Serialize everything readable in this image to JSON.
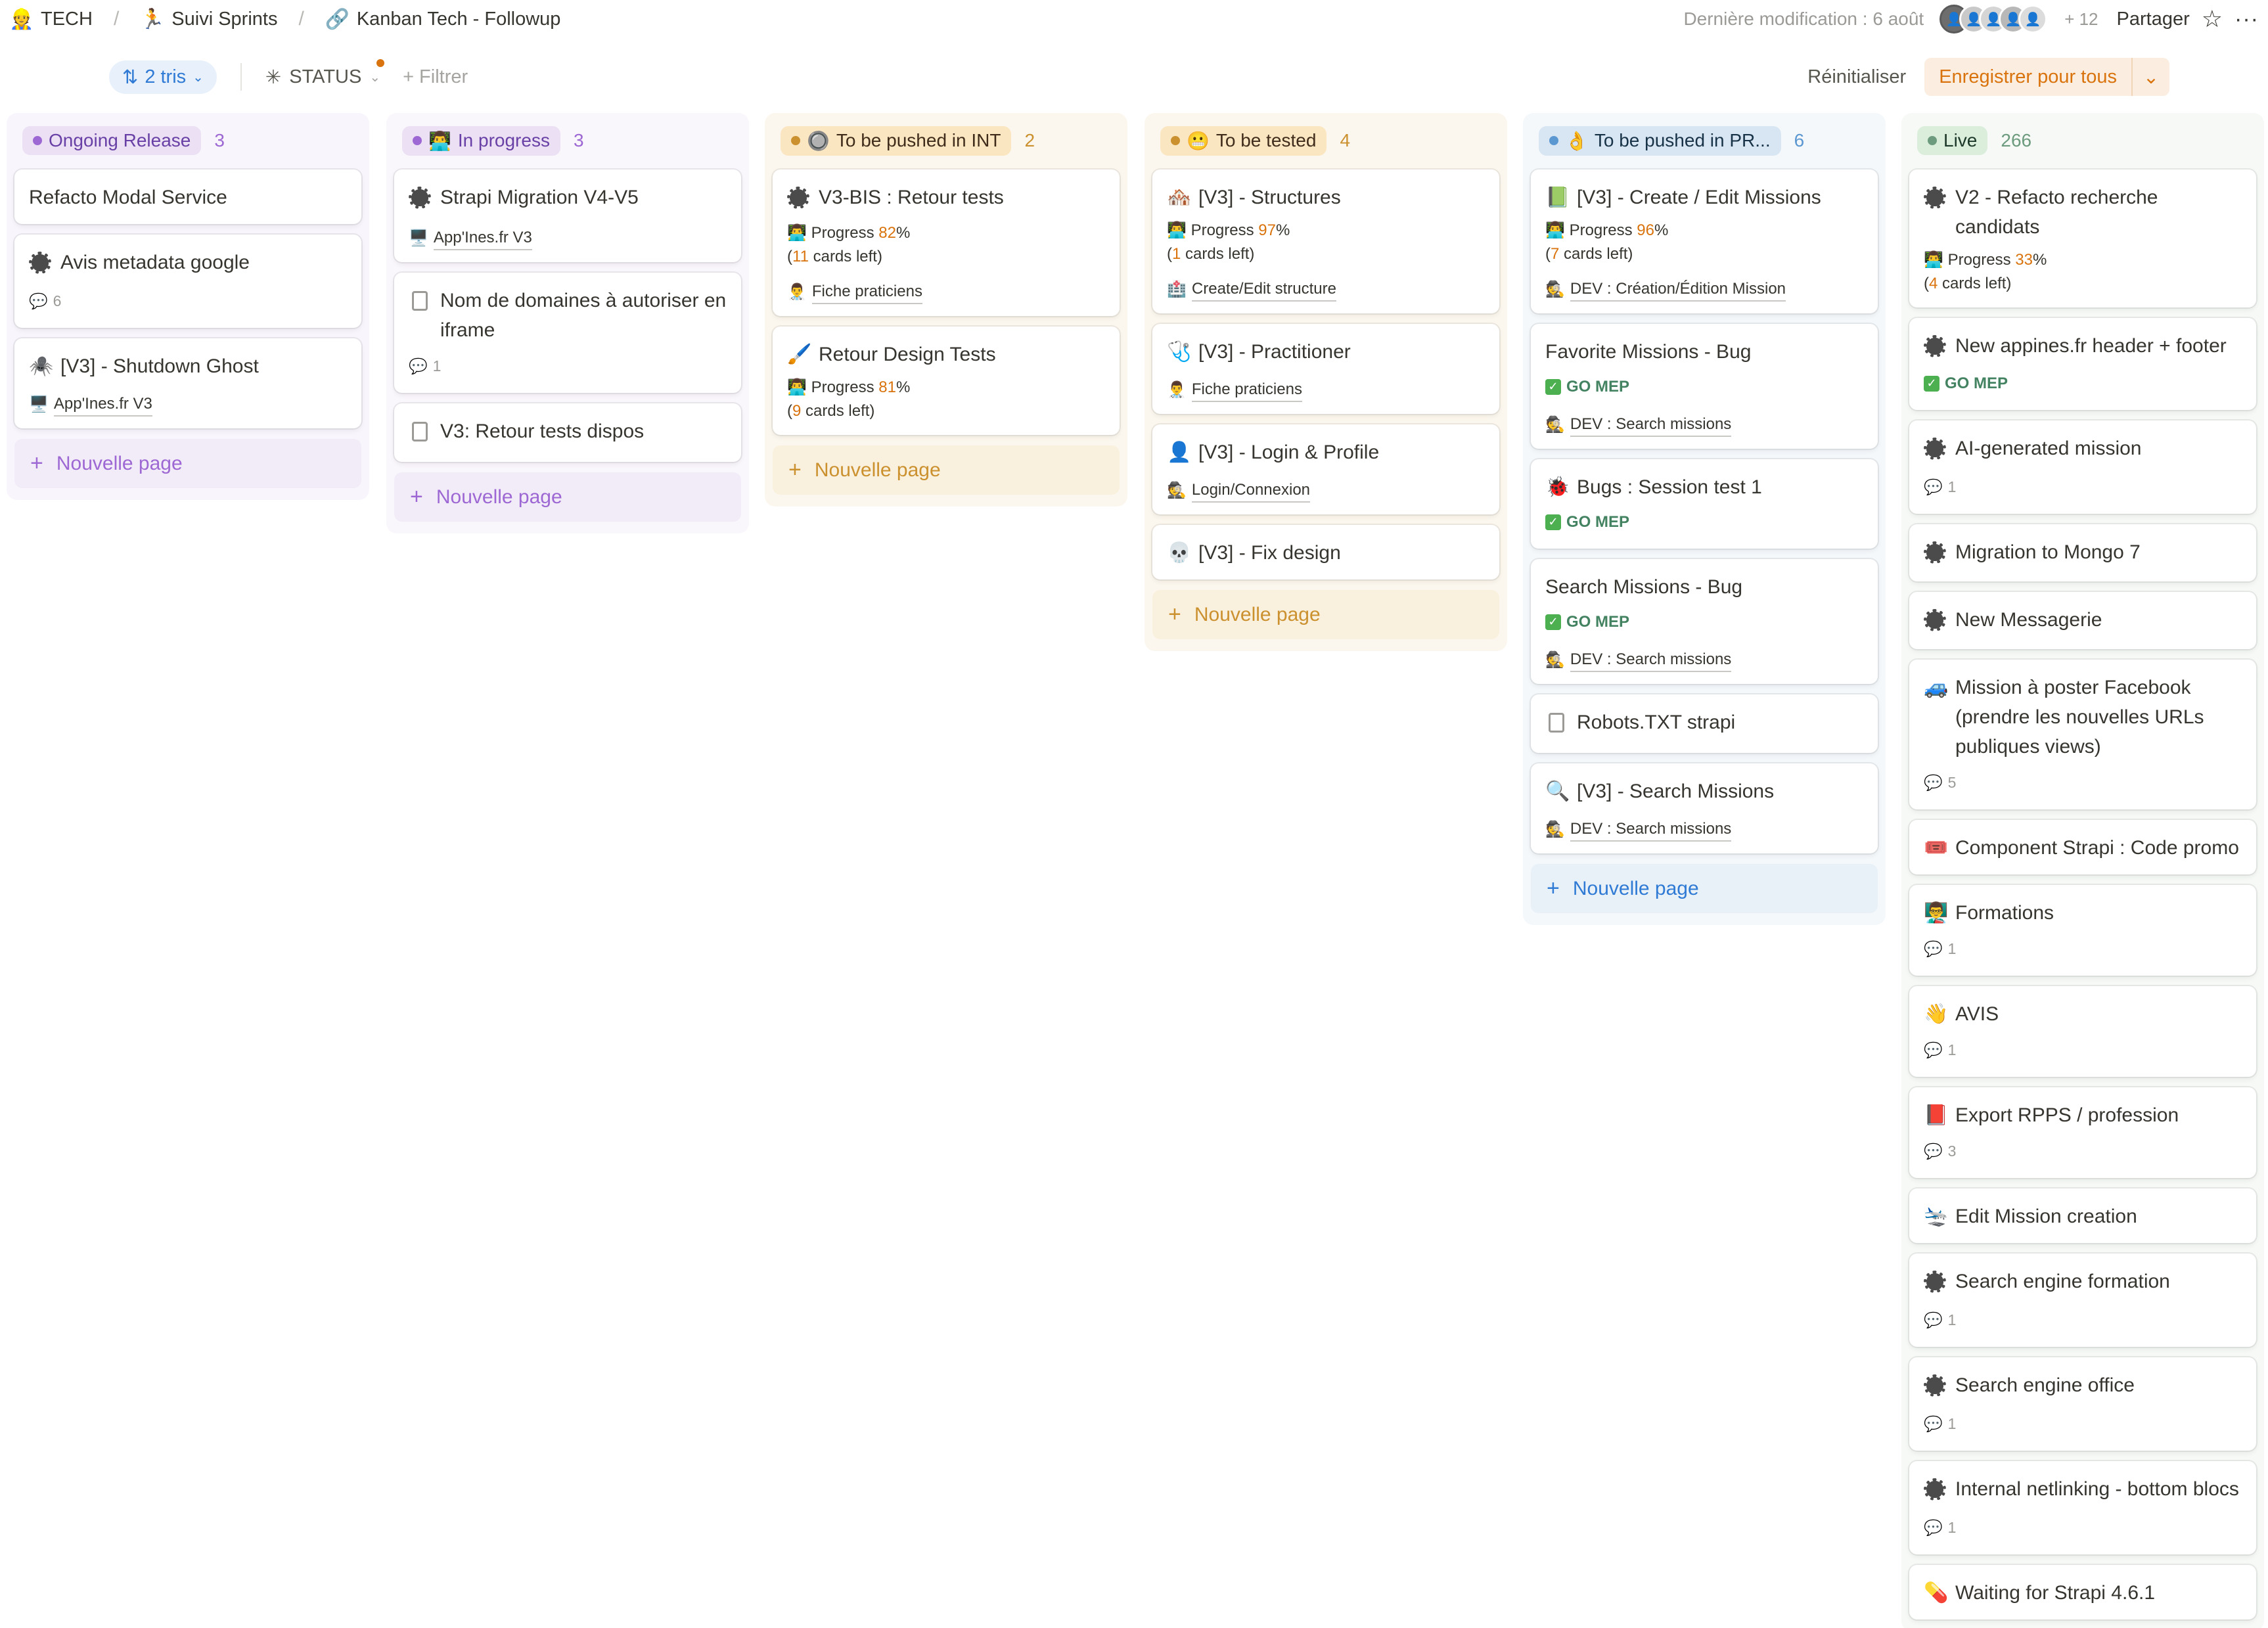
{
  "topbar": {
    "breadcrumbs": [
      {
        "icon": "👷",
        "label": "TECH"
      },
      {
        "icon": "🏃",
        "label": "Suivi Sprints"
      },
      {
        "icon": "🔗",
        "label": "Kanban Tech - Followup"
      }
    ],
    "last_modified": "Dernière modification : 6 août",
    "avatar_more": "+ 12",
    "share_label": "Partager",
    "star_icon": "☆",
    "more_icon": "···"
  },
  "toolbar": {
    "sort_label": "2 tris",
    "group_label": "STATUS",
    "filter_label": "Filtrer",
    "reset_label": "Réinitialiser",
    "save_label": "Enregistrer pour tous"
  },
  "columns": [
    {
      "label": "Ongoing Release",
      "count": "3",
      "tag_icon": "",
      "bg": "#f8f5fc",
      "tag_bg": "#ebe0f4",
      "dot": "#9d68d3",
      "text": "#6940a5",
      "new_page": "Nouvelle page",
      "cards": [
        {
          "title": "Refacto Modal Service",
          "icon": "none"
        },
        {
          "title": "Avis metadata google",
          "icon": "gear",
          "comments": "6"
        },
        {
          "title": "[V3] - Shutdown Ghost",
          "icon": "🕷️",
          "relation": {
            "icon": "🖥️",
            "label": "App'Ines.fr V3"
          }
        }
      ]
    },
    {
      "label": "In progress",
      "count": "3",
      "tag_icon": "👨‍💻",
      "bg": "#f9f6fc",
      "tag_bg": "#ebe0f4",
      "dot": "#9d68d3",
      "text": "#6940a5",
      "new_page": "Nouvelle page",
      "cards": [
        {
          "title": "Strapi Migration V4-V5",
          "icon": "gear",
          "relation": {
            "icon": "🖥️",
            "label": "App'Ines.fr V3"
          }
        },
        {
          "title": "Nom de domaines à autoriser en iframe",
          "icon": "doc",
          "comments": "1"
        },
        {
          "title": "V3: Retour tests dispos",
          "icon": "doc"
        }
      ]
    },
    {
      "label": "To be pushed in INT",
      "count": "2",
      "tag_icon": "🔘",
      "bg": "#fcf7ee",
      "tag_bg": "#fbe6c2",
      "dot": "#cb912f",
      "text": "#402c1b",
      "new_page": "Nouvelle page",
      "cards": [
        {
          "title": "V3-BIS : Retour tests",
          "icon": "gear",
          "progress": "82",
          "cards_left": "11",
          "relation": {
            "icon": "👨‍⚕️",
            "label": "Fiche praticiens"
          }
        },
        {
          "title": "Retour Design Tests",
          "icon": "🖌️",
          "progress": "81",
          "cards_left": "9"
        }
      ]
    },
    {
      "label": "To be tested",
      "count": "4",
      "tag_icon": "😬",
      "bg": "#fcf7ee",
      "tag_bg": "#fbe6c2",
      "dot": "#cb912f",
      "text": "#402c1b",
      "new_page": "Nouvelle page",
      "cards": [
        {
          "title": "[V3] - Structures",
          "icon": "🏘️",
          "progress": "97",
          "cards_left": "1",
          "relation": {
            "icon": "🏥",
            "label": "Create/Edit structure"
          }
        },
        {
          "title": "[V3] - Practitioner",
          "icon": "🩺",
          "relation": {
            "icon": "👨‍⚕️",
            "label": "Fiche praticiens"
          }
        },
        {
          "title": "[V3] - Login & Profile",
          "icon": "👤",
          "relation": {
            "icon": "🕵️",
            "label": "Login/Connexion"
          }
        },
        {
          "title": "[V3] - Fix design",
          "icon": "💀"
        }
      ]
    },
    {
      "label": "To be pushed in PR...",
      "count": "6",
      "tag_icon": "👌",
      "bg": "#f4f8fb",
      "tag_bg": "#d8e6f3",
      "dot": "#5b97d0",
      "text": "#183347",
      "new_page": "Nouvelle page",
      "cards": [
        {
          "title": "[V3] - Create / Edit Missions",
          "icon": "📗",
          "progress": "96",
          "cards_left": "7",
          "relation": {
            "icon": "🕵️",
            "label": "DEV : Création/Édition Mission"
          }
        },
        {
          "title": "Favorite Missions - Bug",
          "icon": "none",
          "gomep": "GO MEP",
          "relation": {
            "icon": "🕵️",
            "label": "DEV : Search missions"
          }
        },
        {
          "title": "Bugs : Session test 1",
          "icon": "🐞",
          "gomep": "GO MEP"
        },
        {
          "title": "Search Missions - Bug",
          "icon": "none",
          "gomep": "GO MEP",
          "relation": {
            "icon": "🕵️",
            "label": "DEV : Search missions"
          }
        },
        {
          "title": "Robots.TXT strapi",
          "icon": "doc"
        },
        {
          "title": "[V3] - Search Missions",
          "icon": "🔍",
          "relation": {
            "icon": "🕵️",
            "label": "DEV : Search missions"
          }
        }
      ]
    },
    {
      "label": "Live",
      "count": "266",
      "tag_icon": "",
      "bg": "#f6f9f6",
      "tag_bg": "#dbeddb",
      "dot": "#6c9b7d",
      "text": "#1c3829",
      "new_page": "",
      "cards": [
        {
          "title": "V2 - Refacto recherche candidats",
          "icon": "gear",
          "progress": "33",
          "cards_left": "4"
        },
        {
          "title": "New appines.fr header + footer",
          "icon": "gear",
          "gomep": "GO MEP"
        },
        {
          "title": "AI-generated mission",
          "icon": "gear",
          "comments": "1"
        },
        {
          "title": "Migration to Mongo 7",
          "icon": "gear"
        },
        {
          "title": "New Messagerie",
          "icon": "gear"
        },
        {
          "title": "Mission à poster Facebook (prendre les nouvelles URLs publiques views)",
          "icon": "🚙",
          "comments": "5"
        },
        {
          "title": "Component Strapi : Code promo",
          "icon": "🎟️"
        },
        {
          "title": "Formations",
          "icon": "👨‍🏫",
          "comments": "1"
        },
        {
          "title": "AVIS",
          "icon": "👋",
          "comments": "1"
        },
        {
          "title": "Export RPPS / profession",
          "icon": "📕",
          "comments": "3"
        },
        {
          "title": "Edit Mission creation",
          "icon": "🛬"
        },
        {
          "title": "Search engine formation",
          "icon": "gear",
          "comments": "1"
        },
        {
          "title": "Search engine office",
          "icon": "gear",
          "comments": "1"
        },
        {
          "title": "Internal netlinking - bottom blocs",
          "icon": "gear",
          "comments": "1"
        },
        {
          "title": "Waiting for Strapi 4.6.1",
          "icon": "💊"
        }
      ]
    }
  ]
}
